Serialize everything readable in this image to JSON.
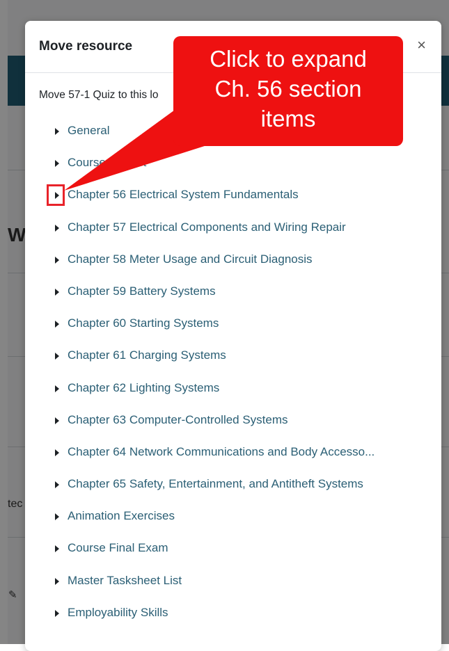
{
  "background": {
    "partial_heading": "Wi",
    "partial_text": "tec"
  },
  "modal": {
    "title": "Move resource",
    "close_label": "×",
    "intro": "Move 57-1 Quiz to this lo",
    "sections": [
      "General",
      "Course Pretest",
      "Chapter 56 Electrical System Fundamentals",
      "Chapter 57 Electrical Components and Wiring Repair",
      "Chapter 58 Meter Usage and Circuit Diagnosis",
      "Chapter 59 Battery Systems",
      "Chapter 60 Starting Systems",
      "Chapter 61 Charging Systems",
      "Chapter 62 Lighting Systems",
      "Chapter 63 Computer-Controlled Systems",
      "Chapter 64 Network Communications and Body Accesso...",
      "Chapter 65 Safety, Entertainment, and Antitheft Systems",
      "Animation Exercises",
      "Course Final Exam",
      "Master Tasksheet List",
      "Employability Skills"
    ]
  },
  "callout": {
    "line1": "Click to expand",
    "line2": "Ch. 56 section",
    "line3": "items",
    "color": "#ee1111"
  }
}
